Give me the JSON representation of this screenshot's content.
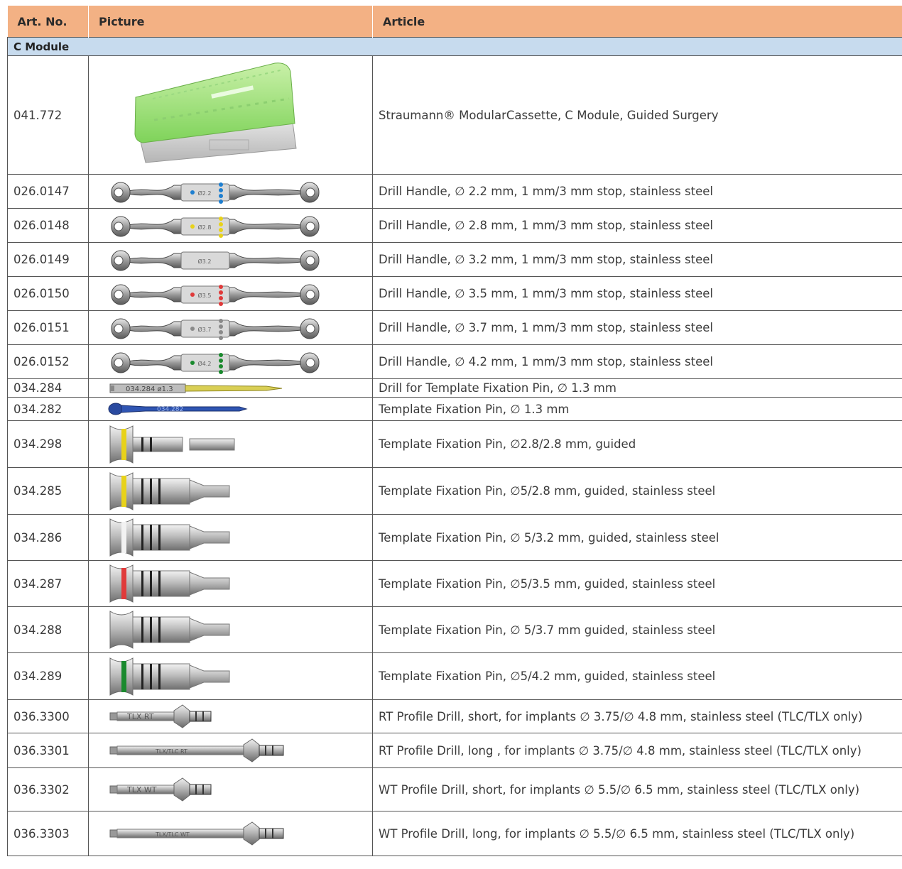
{
  "columns": {
    "art_no": "Art. No.",
    "picture": "Picture",
    "article": "Article"
  },
  "section": "C Module",
  "rows": [
    {
      "art_no": "041.772",
      "article": "Straumann® ModularCassette, C Module, Guided Surgery",
      "picture": "cassette"
    },
    {
      "art_no": "026.0147",
      "article": "Drill Handle, ∅ 2.2 mm, 1 mm/3 mm stop, stainless steel",
      "picture": "drill-handle",
      "label": "Ø2.2",
      "color": "#1e7fd0"
    },
    {
      "art_no": "026.0148",
      "article": "Drill Handle, ∅ 2.8 mm, 1 mm/3 mm stop, stainless steel",
      "picture": "drill-handle",
      "label": "Ø2.8",
      "color": "#e8d21a"
    },
    {
      "art_no": "026.0149",
      "article": "Drill Handle, ∅ 3.2 mm, 1 mm/3 mm stop, stainless steel",
      "picture": "drill-handle",
      "label": "Ø3.2",
      "color": ""
    },
    {
      "art_no": "026.0150",
      "article": "Drill Handle, ∅ 3.5 mm, 1 mm/3 mm stop, stainless steel",
      "picture": "drill-handle",
      "label": "Ø3.5",
      "color": "#e03a3a"
    },
    {
      "art_no": "026.0151",
      "article": "Drill Handle, ∅ 3.7 mm, 1 mm/3 mm stop, stainless steel",
      "picture": "drill-handle",
      "label": "Ø3.7",
      "color": "#8a8a8a"
    },
    {
      "art_no": "026.0152",
      "article": "Drill Handle, ∅ 4.2 mm, 1 mm/3 mm stop, stainless steel",
      "picture": "drill-handle",
      "label": "Ø4.2",
      "color": "#1a8a2e"
    },
    {
      "art_no": "034.284",
      "article": "Drill for Template Fixation Pin, ∅ 1.3 mm",
      "picture": "fix-drill",
      "label": "034.284  ø1.3"
    },
    {
      "art_no": "034.282",
      "article": "Template Fixation Pin, ∅ 1.3 mm",
      "picture": "fix-pin",
      "label": "034.282"
    },
    {
      "art_no": "034.298",
      "article": "Template Fixation Pin, ∅2.8/2.8 mm, guided",
      "picture": "guided-pin",
      "color": "#e8d21a",
      "size": "small"
    },
    {
      "art_no": "034.285",
      "article": "Template Fixation Pin, ∅5/2.8 mm, guided, stainless steel",
      "picture": "guided-pin",
      "color": "#e8d21a",
      "size": "large"
    },
    {
      "art_no": "034.286",
      "article": "Template Fixation Pin, ∅ 5/3.2 mm, guided, stainless steel",
      "picture": "guided-pin",
      "color": "#f2f2f2",
      "size": "large"
    },
    {
      "art_no": "034.287",
      "article": "Template Fixation Pin, ∅5/3.5 mm, guided, stainless steel",
      "picture": "guided-pin",
      "color": "#e03a3a",
      "size": "large"
    },
    {
      "art_no": "034.288",
      "article": "Template Fixation Pin, ∅ 5/3.7 mm guided, stainless steel",
      "picture": "guided-pin",
      "color": "",
      "size": "large"
    },
    {
      "art_no": "034.289",
      "article": "Template Fixation Pin, ∅5/4.2 mm, guided, stainless steel",
      "picture": "guided-pin",
      "color": "#1a8a2e",
      "size": "large"
    },
    {
      "art_no": "036.3300",
      "article": "RT Profile Drill, short, for implants ∅ 3.75/∅ 4.8 mm, stainless steel (TLC/TLX only)",
      "picture": "profile-drill",
      "label": "TLX RT",
      "size": "short"
    },
    {
      "art_no": "036.3301",
      "article": "RT Profile Drill, long , for implants ∅ 3.75/∅ 4.8 mm, stainless steel (TLC/TLX only)",
      "picture": "profile-drill",
      "label": "TLX/TLC RT",
      "size": "long"
    },
    {
      "art_no": "036.3302",
      "article": "WT Profile Drill, short, for implants ∅ 5.5/∅ 6.5 mm, stainless steel (TLC/TLX only)",
      "picture": "profile-drill",
      "label": "TLX WT",
      "size": "short"
    },
    {
      "art_no": "036.3303",
      "article": "WT Profile Drill, long, for implants ∅ 5.5/∅ 6.5 mm, stainless steel (TLC/TLX only)",
      "picture": "profile-drill",
      "label": "TLX/TLC WT",
      "size": "long"
    }
  ]
}
